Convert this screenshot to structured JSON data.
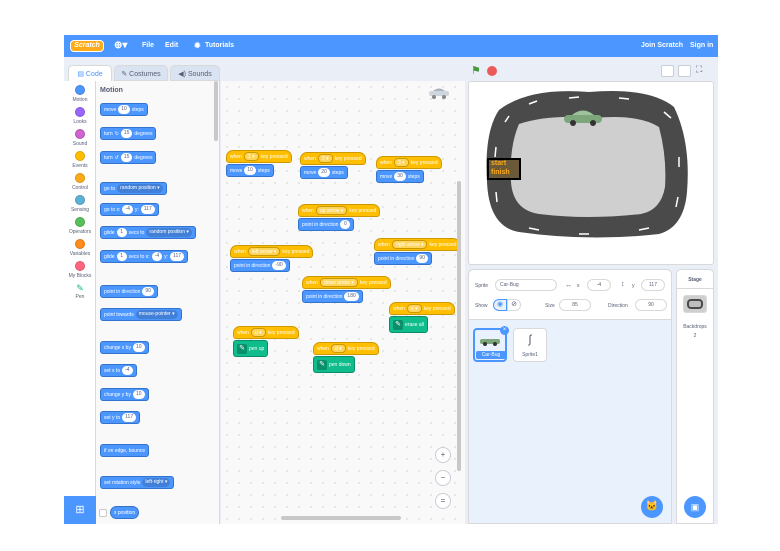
{
  "menu": {
    "logo": "Scratch",
    "file": "File",
    "edit": "Edit",
    "tutorials": "Tutorials",
    "join": "Join Scratch",
    "signin": "Sign in"
  },
  "tabs": {
    "code": "Code",
    "costumes": "Costumes",
    "sounds": "Sounds"
  },
  "categories": [
    {
      "label": "Motion",
      "color": "#4c97ff"
    },
    {
      "label": "Looks",
      "color": "#9966ff"
    },
    {
      "label": "Sound",
      "color": "#cf63cf"
    },
    {
      "label": "Events",
      "color": "#ffbf00"
    },
    {
      "label": "Control",
      "color": "#ffab19"
    },
    {
      "label": "Sensing",
      "color": "#5cb1d6"
    },
    {
      "label": "Operators",
      "color": "#59c059"
    },
    {
      "label": "Variables",
      "color": "#ff8c1a"
    },
    {
      "label": "My Blocks",
      "color": "#ff6680"
    },
    {
      "label": "Pen",
      "color": "#0fbd8c"
    }
  ],
  "palette": {
    "heading": "Motion",
    "move": {
      "a": "move",
      "n": "10",
      "b": "steps"
    },
    "turn_right": {
      "a": "turn",
      "n": "15",
      "b": "degrees"
    },
    "turn_left": {
      "a": "turn",
      "n": "15",
      "b": "degrees"
    },
    "goto": {
      "a": "go to",
      "d": "random position"
    },
    "gotoxy": {
      "a": "go to x:",
      "x": "-4",
      "b": "y:",
      "y": "117"
    },
    "glide1": {
      "a": "glide",
      "n": "1",
      "b": "secs to",
      "d": "random position"
    },
    "glide2": {
      "a": "glide",
      "n": "1",
      "b": "secs to x:",
      "x": "-4",
      "c": "y:",
      "y": "117"
    },
    "point_dir": {
      "a": "point in direction",
      "n": "90"
    },
    "point_towards": {
      "a": "point towards",
      "d": "mouse-pointer"
    },
    "change_x": {
      "a": "change x by",
      "n": "10"
    },
    "set_x": {
      "a": "set x to",
      "n": "-4"
    },
    "change_y": {
      "a": "change y by",
      "n": "10"
    },
    "set_y": {
      "a": "set y to",
      "n": "117"
    },
    "bounce": "if on edge, bounce",
    "rotation": {
      "a": "set rotation style",
      "d": "left-right"
    },
    "xpos": "x position"
  },
  "scripts": {
    "s1": {
      "when": "when",
      "key": "1",
      "pressed": "key pressed",
      "a": "move",
      "n": "10",
      "b": "steps"
    },
    "s2": {
      "when": "when",
      "key": "2",
      "pressed": "key pressed",
      "a": "move",
      "n": "20",
      "b": "steps"
    },
    "s3": {
      "when": "when",
      "key": "3",
      "pressed": "key pressed",
      "a": "move",
      "n": "30",
      "b": "steps"
    },
    "s4": {
      "when": "when",
      "key": "up arrow",
      "pressed": "key pressed",
      "a": "point in direction",
      "n": "0"
    },
    "s5": {
      "when": "when",
      "key": "left arrow",
      "pressed": "key pressed",
      "a": "point in direction",
      "n": "-90"
    },
    "s6": {
      "when": "when",
      "key": "right arrow",
      "pressed": "key pressed",
      "a": "point in direction",
      "n": "90"
    },
    "s7": {
      "when": "when",
      "key": "down arrow",
      "pressed": "key pressed",
      "a": "point in direction",
      "n": "180"
    },
    "s8": {
      "when": "when",
      "key": "e",
      "pressed": "key pressed",
      "a": "erase all"
    },
    "s9": {
      "when": "when",
      "key": "u",
      "pressed": "key pressed",
      "a": "pen up"
    },
    "s10": {
      "when": "when",
      "key": "d",
      "pressed": "key pressed",
      "a": "pen down"
    }
  },
  "stage": {
    "start": "start",
    "finish": "finish"
  },
  "sprite_info": {
    "sprite_label": "Sprite",
    "sprite_name": "Car-Bug",
    "x_label": "x",
    "x": "-4",
    "y_label": "y",
    "y": "117",
    "show_label": "Show",
    "size_label": "Size",
    "size": "85",
    "direction_label": "Direction",
    "direction": "90"
  },
  "sprites": [
    {
      "name": "Car-Bug"
    },
    {
      "name": "Sprite1"
    }
  ],
  "stage_pane": {
    "title": "Stage",
    "backdrops_label": "Backdrops",
    "backdrops_count": "2"
  },
  "zoom": {
    "in": "+",
    "out": "−",
    "reset": "="
  }
}
